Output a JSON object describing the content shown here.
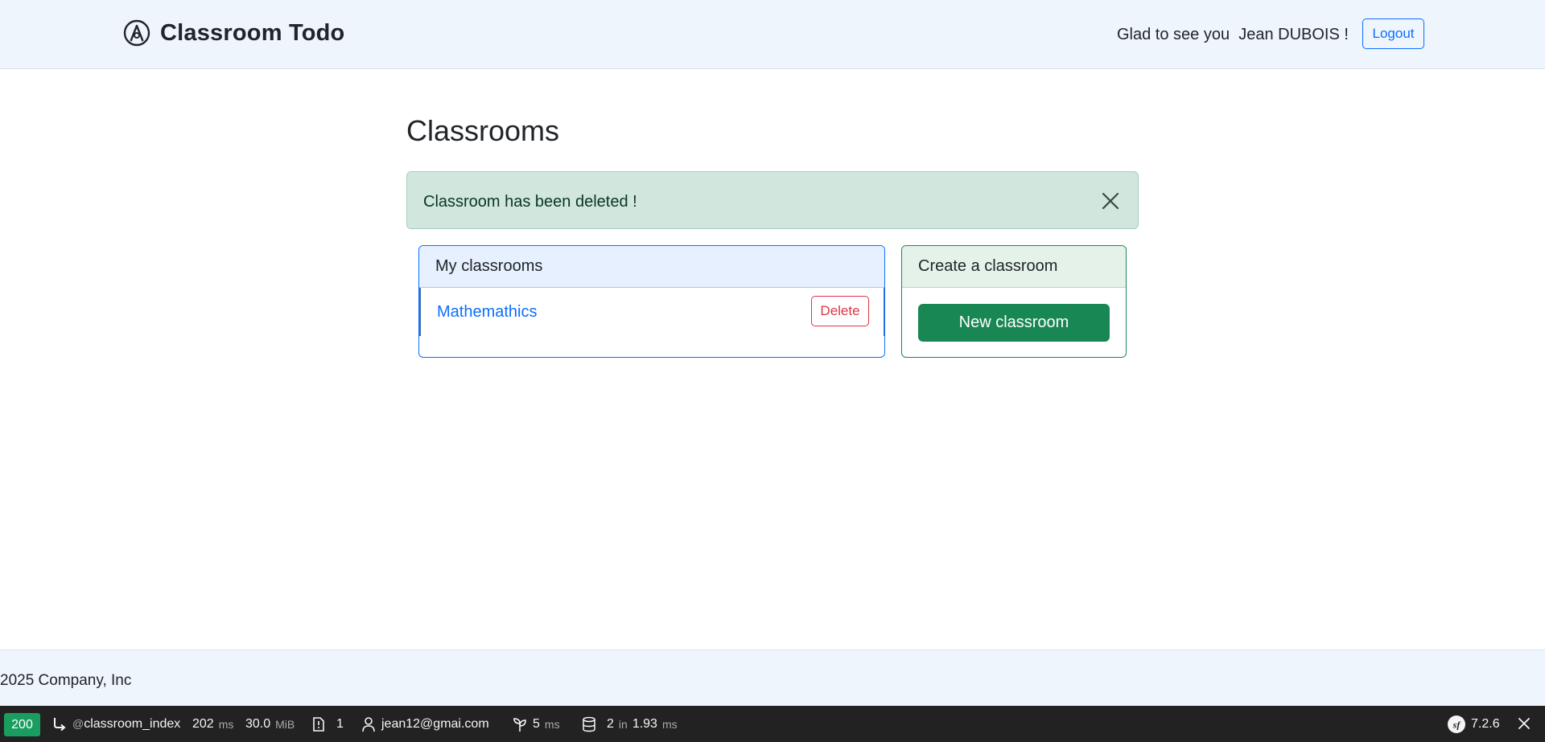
{
  "navbar": {
    "brand": "Classroom Todo",
    "greeting": "Glad to see you  Jean DUBOIS !",
    "logout_label": "Logout"
  },
  "main": {
    "title": "Classrooms",
    "alert": {
      "message": "Classroom has been deleted !"
    },
    "my_classrooms": {
      "header": "My classrooms",
      "items": [
        {
          "name": "Mathemathics",
          "delete_label": "Delete"
        }
      ]
    },
    "create": {
      "header": "Create a classroom",
      "button_label": "New classroom"
    }
  },
  "footer": {
    "text": "2025 Company, Inc"
  },
  "debug_toolbar": {
    "status": "200",
    "route_prefix": "@",
    "route": "classroom_index",
    "time_value": "202",
    "time_unit": "ms",
    "memory_value": "30.0",
    "memory_unit": "MiB",
    "logs_count": "1",
    "user": "jean12@gmai.com",
    "twig_value": "5",
    "twig_unit": "ms",
    "db_queries": "2",
    "db_in": "in",
    "db_time": "1.93",
    "db_unit": "ms",
    "symfony_version": "7.2.6"
  },
  "colors": {
    "primary": "#0d6efd",
    "success": "#198754",
    "danger": "#dc3545",
    "navbar_bg": "#eef5fd",
    "alert_bg": "#d1e7dd",
    "toolbar_bg": "#222222",
    "status_green": "#1a9e5f"
  },
  "icons": {
    "brand": "bootstrap-logo-icon",
    "alert_close": "close-icon",
    "route": "route-arrow-icon",
    "logs": "log-icon",
    "user": "user-icon",
    "twig": "twig-leaf-icon",
    "database": "database-icon",
    "symfony": "symfony-logo-icon",
    "toolbar_close": "close-icon"
  }
}
